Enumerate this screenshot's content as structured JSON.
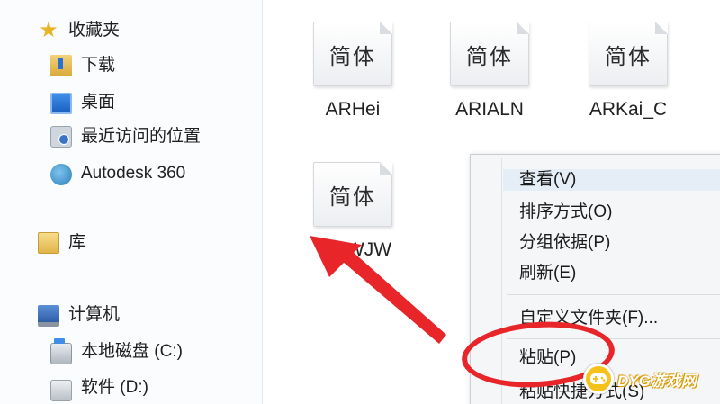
{
  "nav": {
    "favorites": "收藏夹",
    "downloads": "下载",
    "desktop": "桌面",
    "recent": "最近访问的位置",
    "autodesk": "Autodesk 360",
    "libraries": "库",
    "computer": "计算机",
    "drive_c": "本地磁盘 (C:)",
    "drive_d": "软件 (D:)"
  },
  "files": [
    {
      "name": "ARHei",
      "glyph": "简体"
    },
    {
      "name": "ARIALN",
      "glyph": "简体"
    },
    {
      "name": "ARKai_C",
      "glyph": "简体"
    },
    {
      "name": "WJW",
      "glyph": "简体"
    }
  ],
  "context_menu": {
    "view": "查看(V)",
    "sort": "排序方式(O)",
    "group": "分组依据(P)",
    "refresh": "刷新(E)",
    "customize": "自定义文件夹(F)...",
    "paste": "粘贴(P)",
    "paste_shortcut": "粘贴快捷方式(S)"
  },
  "annotation": {
    "color": "#e8262a"
  },
  "watermark": {
    "text": "DYG游戏网"
  }
}
